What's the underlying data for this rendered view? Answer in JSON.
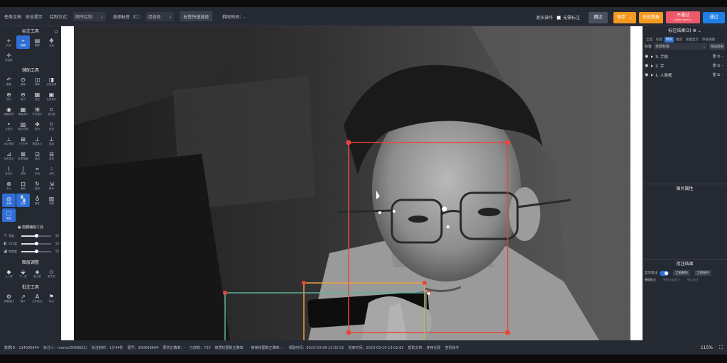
{
  "topbar": {
    "menu": [
      "任务文档",
      "安全提示"
    ],
    "draw_mode_label": "绘制方式：",
    "draw_mode_value": "顺序绘制",
    "tag_label": "选择标签（C）：",
    "tag_value": "请选择",
    "quick_tag_button": "标签快速选择",
    "elapsed_label": "耗时时间：-",
    "more_ops": "更多操作",
    "no_label_text": "无需标注",
    "pass_button": "跳过",
    "save_button": "保存",
    "invalid_button": "无效数据",
    "reject_button": "不通过",
    "reject_sub": "(shift+ctrl+1)",
    "submit_button": "通过"
  },
  "left_panel": {
    "annotation_tools_title": "标注工具",
    "annotation_tools": [
      {
        "label": "标注",
        "icon": "plus-icon",
        "glyph": "+"
      },
      {
        "label": "编辑",
        "icon": "edit-points-icon",
        "glyph": "⌖",
        "active": true
      },
      {
        "label": "删除",
        "icon": "trash-icon",
        "glyph": "▤"
      },
      {
        "label": "全选",
        "icon": "select-all-icon",
        "glyph": "✥"
      },
      {
        "label": "标准框",
        "icon": "frame-icon",
        "glyph": "✛"
      }
    ],
    "aux_tools_title": "辅助工具",
    "aux_tools": [
      {
        "label": "撤销",
        "icon": "undo-icon",
        "glyph": "↶"
      },
      {
        "label": "重做",
        "icon": "redo-icon",
        "glyph": "⊙"
      },
      {
        "label": "清除",
        "icon": "clear-icon",
        "glyph": "◫"
      },
      {
        "label": "全部还原",
        "icon": "reset-icon",
        "glyph": "◨"
      },
      {
        "label": "放大",
        "icon": "zoom-in-icon",
        "glyph": "⊕"
      },
      {
        "label": "缩小",
        "icon": "zoom-out-icon",
        "glyph": "⊖"
      },
      {
        "label": "适应",
        "icon": "fit-icon",
        "glyph": "▦"
      },
      {
        "label": "全部显示",
        "icon": "show-all-icon",
        "glyph": "▣"
      },
      {
        "label": "隐藏其他",
        "icon": "eye-icon",
        "glyph": "◉"
      },
      {
        "label": "隐藏选中",
        "icon": "grid-icon",
        "glyph": "▦"
      },
      {
        "label": "外侧显示",
        "icon": "outer-icon",
        "glyph": "⊞"
      },
      {
        "label": "显示框",
        "icon": "box-show-icon",
        "glyph": "⌗"
      },
      {
        "label": "点显示",
        "icon": "point-icon",
        "glyph": "•"
      },
      {
        "label": "图片切换",
        "icon": "image-switch-icon",
        "glyph": "▨"
      },
      {
        "label": "拖动",
        "icon": "drag-icon",
        "glyph": "✥"
      },
      {
        "label": "框选",
        "icon": "box-select-icon",
        "glyph": "⌑"
      },
      {
        "label": "水平镜像",
        "icon": "flip-h-icon",
        "glyph": "⊥"
      },
      {
        "label": "上下对齐",
        "icon": "align-v-icon",
        "glyph": "⊞"
      },
      {
        "label": "垂直水平",
        "icon": "hv-icon",
        "glyph": "⊥"
      },
      {
        "label": "复制",
        "icon": "copy-icon",
        "glyph": "⊥"
      },
      {
        "label": "标签显示",
        "icon": "tag-icon",
        "glyph": "⊿"
      },
      {
        "label": "标签隐藏",
        "icon": "tag-hide-icon",
        "glyph": "⊠"
      },
      {
        "label": "超出",
        "icon": "overflow-icon",
        "glyph": "⊡"
      },
      {
        "label": "重叠",
        "icon": "overlap-icon",
        "glyph": "⊟"
      },
      {
        "label": "多边形",
        "icon": "polygon-icon",
        "glyph": "⌇"
      },
      {
        "label": "曲线",
        "icon": "curve-icon",
        "glyph": "∫"
      },
      {
        "label": "折线",
        "icon": "polyline-icon",
        "glyph": "⌗"
      },
      {
        "label": "点阵",
        "icon": "dots-icon",
        "glyph": "⁘"
      },
      {
        "label": "中心",
        "icon": "center-icon",
        "glyph": "⊗"
      },
      {
        "label": "裁剪",
        "icon": "crop-icon",
        "glyph": "⊡"
      },
      {
        "label": "旋转",
        "icon": "rotate-icon",
        "glyph": "↻"
      },
      {
        "label": "移动",
        "icon": "move-icon",
        "glyph": "⇲"
      },
      {
        "label": "区域",
        "icon": "region-icon",
        "glyph": "◍",
        "active": true
      },
      {
        "label": "边缘",
        "icon": "edge-icon",
        "glyph": "▚",
        "active": true
      },
      {
        "label": "属性",
        "icon": "attr-icon",
        "glyph": "♁"
      },
      {
        "label": "测量",
        "icon": "measure-icon",
        "glyph": "▥"
      },
      {
        "label": "遮挡",
        "icon": "mask-icon",
        "glyph": "☐",
        "active": true
      }
    ],
    "image_adjust_title": "隐藏辅助工具",
    "sliders": [
      {
        "label": "亮度",
        "icon": "brightness-icon",
        "glyph": "☼",
        "value": 50
      },
      {
        "label": "对比度",
        "icon": "contrast-icon",
        "glyph": "◐",
        "value": 50
      },
      {
        "label": "饱和度",
        "icon": "saturation-icon",
        "glyph": "◕",
        "value": 50
      }
    ],
    "layer_title": "图层调整",
    "layer_tools": [
      {
        "label": "上一层",
        "icon": "layer-up-icon",
        "glyph": "◆"
      },
      {
        "label": "下一层",
        "icon": "layer-down-icon",
        "glyph": "⬙"
      },
      {
        "label": "最上层",
        "icon": "layer-top-icon",
        "glyph": "◈"
      },
      {
        "label": "最下层",
        "icon": "layer-bottom-icon",
        "glyph": "◇"
      }
    ],
    "review_title": "批注工具",
    "review_tools": [
      {
        "label": "设置批注",
        "icon": "annotate-icon",
        "glyph": "⚙"
      },
      {
        "label": "箭头",
        "icon": "arrow-icon",
        "glyph": "↗"
      },
      {
        "label": "文字批注",
        "icon": "text-icon",
        "glyph": "A"
      },
      {
        "label": "标记",
        "icon": "marker-icon",
        "glyph": "⚑"
      }
    ]
  },
  "right_panel": {
    "results_title": "标注结果(3)",
    "tabs": [
      "全选",
      "标签",
      "时间",
      "组合",
      "质量显示",
      "审核视图"
    ],
    "active_tab": 2,
    "filter_label": "标签",
    "filter_value": "全部标签",
    "filter_button": "筛选结果",
    "objects": [
      {
        "name": "3. 手机"
      },
      {
        "name": "2. 手"
      },
      {
        "name": "1. 人脸框"
      }
    ],
    "image_attr_title": "图片属性",
    "review_result_title": "批注结果",
    "show_review_label": "显示批注",
    "clear_all_button": "全部删除",
    "fold_all_button": "全部展开",
    "review_actions": [
      "撤销批注",
      "删除全部批注",
      "确认批注"
    ]
  },
  "bottom": {
    "items": [
      "数据ID：114005644",
      "标注人：momo(3058621)",
      "标注耗时：1分44秒",
      "图号：260668694",
      "要求正确率：-",
      "已修数：735",
      "被质检图数正确率：",
      "被审核图数正确率：-",
      "领取时间：2023-03-09 13:02:02",
      "结束时间：2023-03-10 13:02:02",
      "帮助文档",
      "使用反馈",
      "查看操作"
    ],
    "zoom": "115%"
  },
  "colors": {
    "face_box": "#e8463a",
    "phone_box": "#f0a040",
    "hand_box": "#5fb0a0",
    "accent": "#2f6fd6",
    "save": "#f39a1e",
    "reject": "#ec5a6a",
    "submit": "#1f7fe6"
  }
}
